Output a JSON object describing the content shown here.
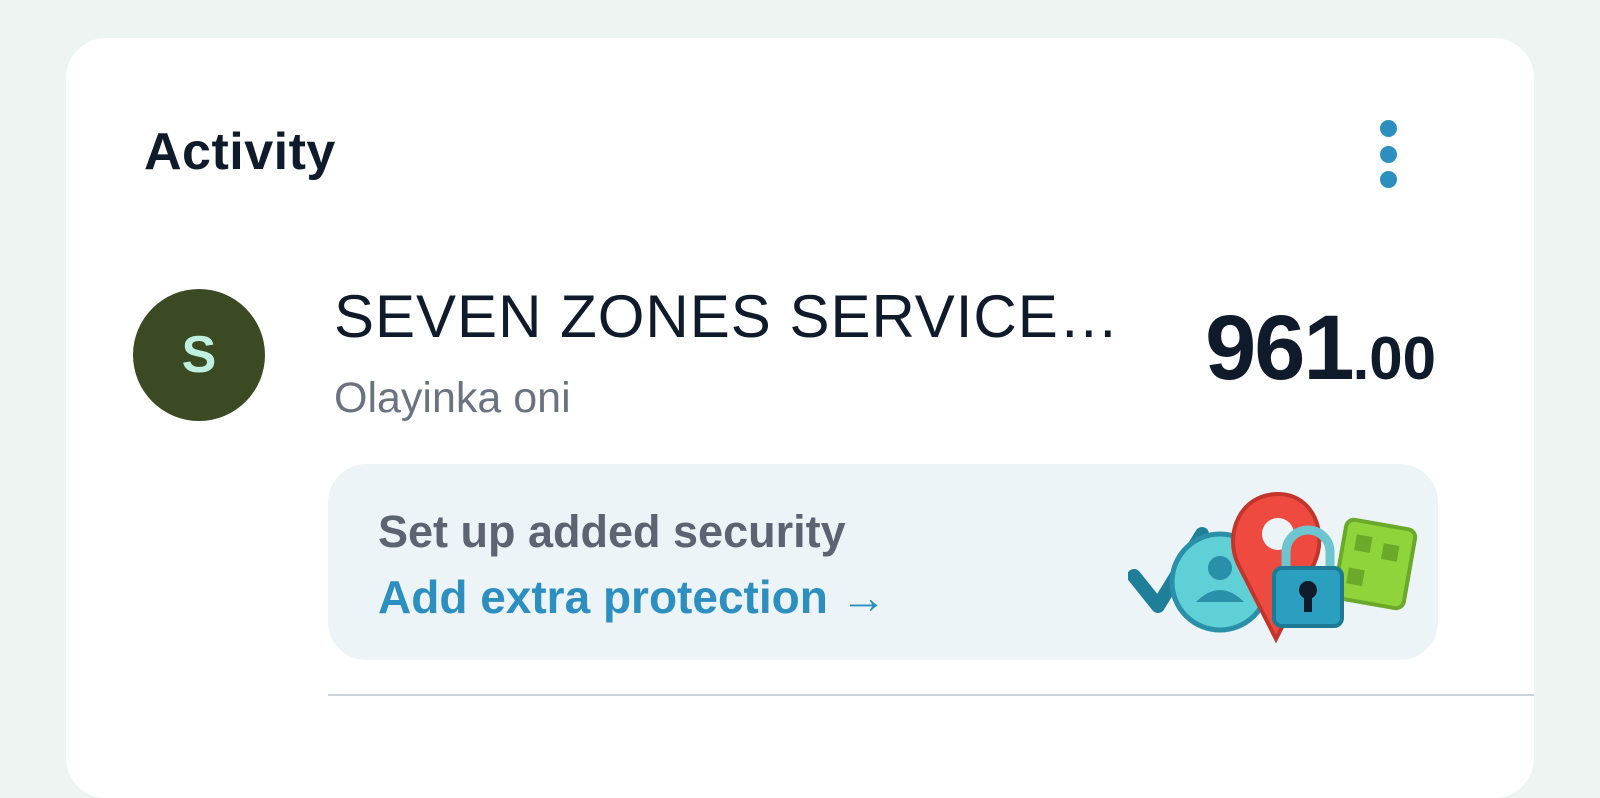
{
  "header": {
    "title": "Activity",
    "menu_icon": "more-vertical-icon"
  },
  "transaction": {
    "avatar_initial": "S",
    "merchant": "SEVEN ZONES SERVICE…",
    "payer": "Olayinka oni",
    "amount_whole": "961",
    "amount_decimal": ".00"
  },
  "promo": {
    "title": "Set up added security",
    "link": "Add extra protection →",
    "illustration": "security-illustration"
  },
  "colors": {
    "accent": "#2d8fc0",
    "avatar_bg": "#3b4a22",
    "avatar_fg": "#bff0e0",
    "promo_bg": "#edf4f8"
  }
}
